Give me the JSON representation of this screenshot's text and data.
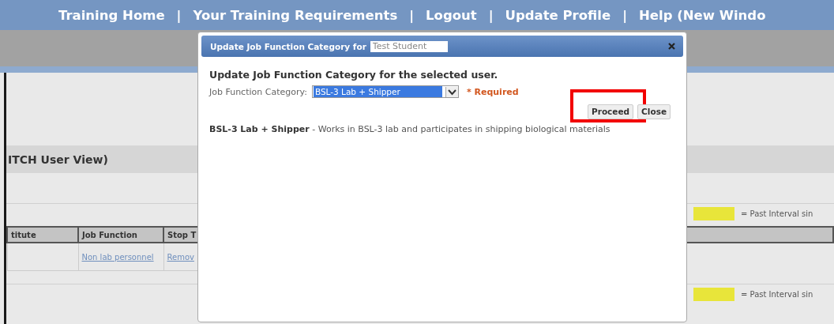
{
  "nav": [
    {
      "kind": "link",
      "text": "Training Home"
    },
    {
      "kind": "separator",
      "text": "|"
    },
    {
      "kind": "link",
      "text": "Your Training Requirements"
    },
    {
      "kind": "separator",
      "text": "|"
    },
    {
      "kind": "link",
      "text": "Logout"
    },
    {
      "kind": "separator",
      "text": "|"
    },
    {
      "kind": "link",
      "text": "Update Profile"
    },
    {
      "kind": "separator",
      "text": "|"
    },
    {
      "kind": "link",
      "text": "Help (New Windo"
    }
  ],
  "page": {
    "section_title": "ITCH User View)",
    "legend": [
      {
        "text": "= Past Interval sin"
      },
      {
        "text": "= Past Interval sin"
      }
    ],
    "table": {
      "columns": [
        "titute",
        "Job Function",
        "Stop T"
      ],
      "rows": [
        [
          {
            "kind": "text",
            "text": ""
          },
          {
            "kind": "link",
            "text": "Non lab personnel"
          },
          {
            "kind": "link",
            "text": "Remov"
          }
        ]
      ]
    }
  },
  "dialog": {
    "title": "Update Job Function Category for",
    "user_field": {
      "value": "Test Student"
    },
    "heading": "Update Job Function Category for the selected user.",
    "field_label": "Job Function Category:",
    "select": {
      "value": "BSL-3 Lab + Shipper"
    },
    "required": "* Required",
    "buttons": [
      {
        "label": "Proceed",
        "highlighted": true
      },
      {
        "label": "Close",
        "highlighted": false
      }
    ],
    "description": "**BSL-3 Lab + Shipper** - Works in BSL-3 lab and participates in shipping biological materials"
  }
}
